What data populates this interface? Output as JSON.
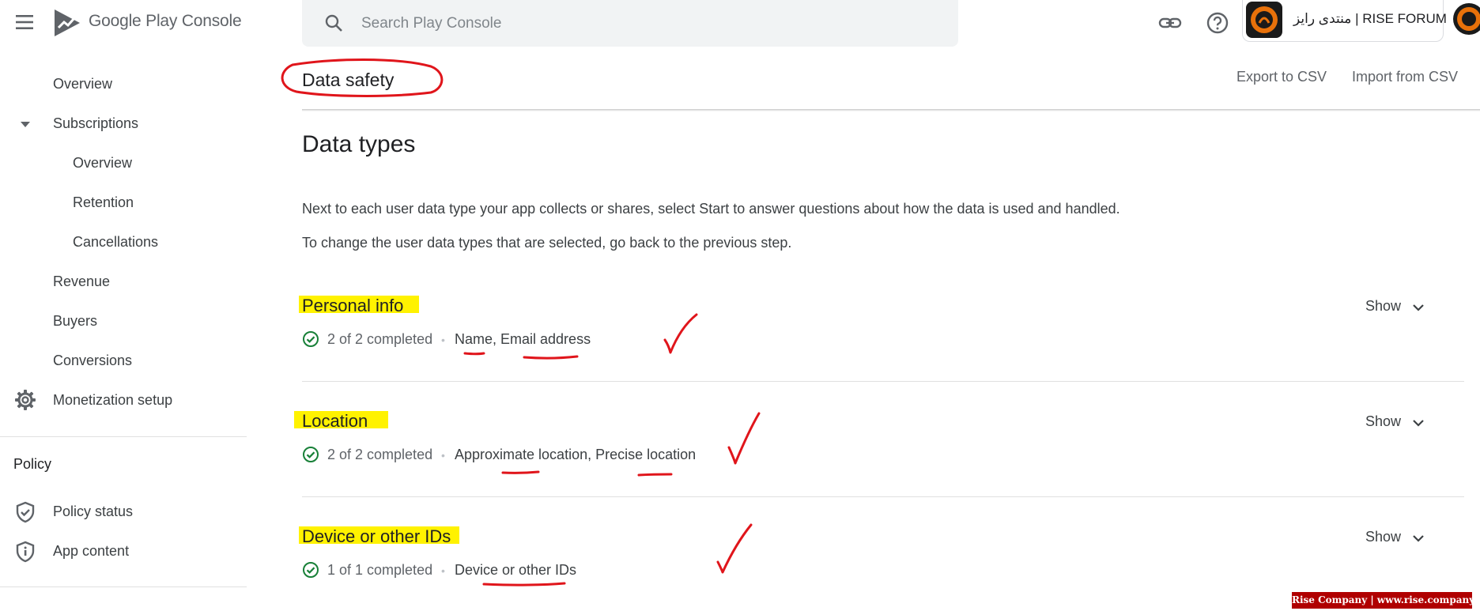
{
  "app": {
    "logo_text": "Google Play Console"
  },
  "search": {
    "placeholder": "Search Play Console",
    "value": ""
  },
  "account": {
    "name": "منتدی رایز | RISE FORUM"
  },
  "sidebar": {
    "items": [
      {
        "label": "Overview"
      },
      {
        "label": "Subscriptions"
      },
      {
        "label": "Overview"
      },
      {
        "label": "Retention"
      },
      {
        "label": "Cancellations"
      },
      {
        "label": "Revenue"
      },
      {
        "label": "Buyers"
      },
      {
        "label": "Conversions"
      },
      {
        "label": "Monetization setup"
      }
    ],
    "policy_section": {
      "title": "Policy",
      "items": [
        {
          "label": "Policy status"
        },
        {
          "label": "App content"
        }
      ]
    }
  },
  "header": {
    "title": "Data safety",
    "export_label": "Export to CSV",
    "import_label": "Import from CSV"
  },
  "main": {
    "section_title": "Data types",
    "description_1": "Next to each user data type your app collects or shares, select Start to answer questions about how the data is used and handled.",
    "description_2": "To change the user data types that are selected, go back to the previous step.",
    "data_types": [
      {
        "title": "Personal info",
        "status": "2 of 2 completed",
        "types": "Name, Email address",
        "show_label": "Show"
      },
      {
        "title": "Location",
        "status": "2 of 2 completed",
        "types": "Approximate location, Precise location",
        "show_label": "Show"
      },
      {
        "title": "Device or other IDs",
        "status": "1 of 1 completed",
        "types": "Device or other IDs",
        "show_label": "Show"
      }
    ]
  },
  "watermark": {
    "text": "Rise Company | www.rise.company"
  },
  "colors": {
    "highlight": "#fff200",
    "annotation_red": "#e0151b",
    "success_green": "#188038",
    "logo_accent": "#e8710a"
  }
}
